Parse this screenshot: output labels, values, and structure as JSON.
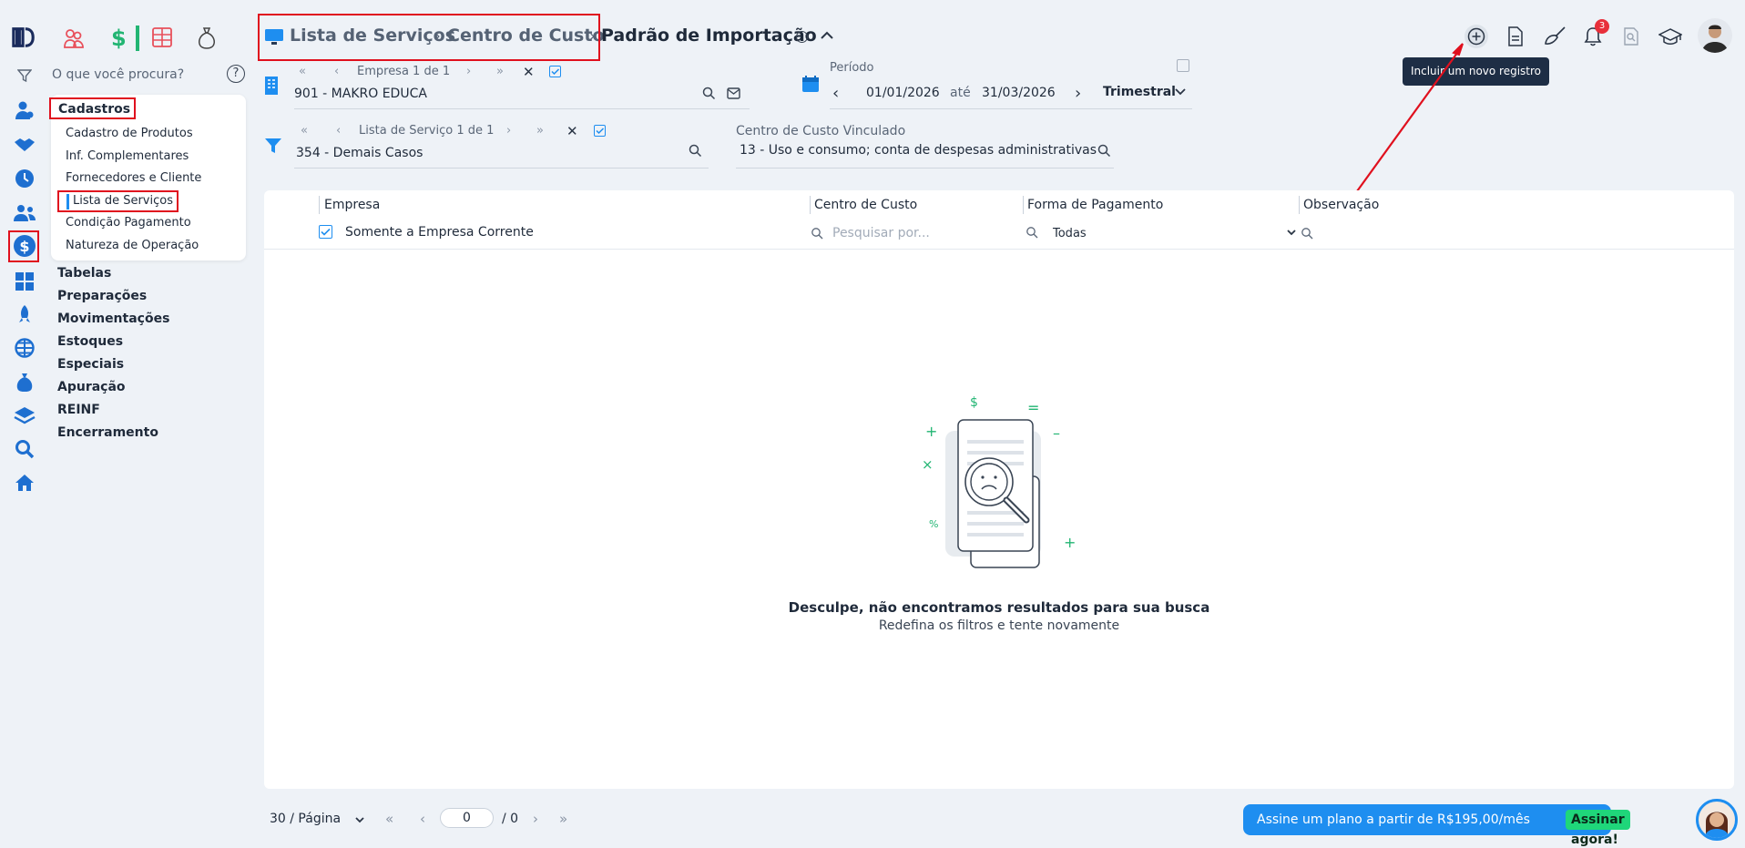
{
  "search": {
    "placeholder": "O que você procura?"
  },
  "breadcrumb": {
    "item1": "Lista de Serviços",
    "item2": "Centro de Custo",
    "current": "Padrão de Importação"
  },
  "empresa_filter": {
    "nav_label": "Empresa 1 de 1",
    "value": "901 - MAKRO EDUCA"
  },
  "periodo": {
    "label": "Período",
    "start": "01/01/2026",
    "between": "até",
    "end": "31/03/2026",
    "mode": "Trimestral"
  },
  "servico_filter": {
    "nav_label": "Lista de Serviço 1 de 1",
    "value": "354 - Demais Casos"
  },
  "centro_vinculado": {
    "label": "Centro de Custo Vinculado",
    "value": "13 - Uso e consumo; conta de despesas administrativas"
  },
  "tooltip": {
    "text": "Incluir um novo registro"
  },
  "notifications": {
    "count": "3"
  },
  "menu": {
    "cadastros": "Cadastros",
    "cadastros_items": [
      "Cadastro de Produtos",
      "Inf. Complementares",
      "Fornecedores e Cliente",
      "Lista de Serviços",
      "Condição Pagamento",
      "Natureza de Operação"
    ],
    "sections": [
      "Tabelas",
      "Preparações",
      "Movimentações",
      "Estoques",
      "Especiais",
      "Apuração",
      "REINF",
      "Encerramento"
    ]
  },
  "table": {
    "columns": [
      "Empresa",
      "Centro de Custo",
      "Forma de Pagamento",
      "Observação"
    ],
    "empresa_filter_label": "Somente a Empresa Corrente",
    "centro_placeholder": "Pesquisar por...",
    "forma_value": "Todas"
  },
  "empty": {
    "title": "Desculpe, não encontramos resultados para sua busca",
    "subtitle": "Redefina os filtros e tente novamente"
  },
  "pagination": {
    "per_page": "30 / Página",
    "page": "0",
    "total": "/ 0"
  },
  "promo": {
    "text": "Assine um plano a partir de R$195,00/mês",
    "cta": "Assinar agora!"
  },
  "colors": {
    "accent": "#1e8ef0",
    "danger": "#e0101e",
    "brand": "#1a2b5c",
    "cta": "#1fd67a"
  }
}
